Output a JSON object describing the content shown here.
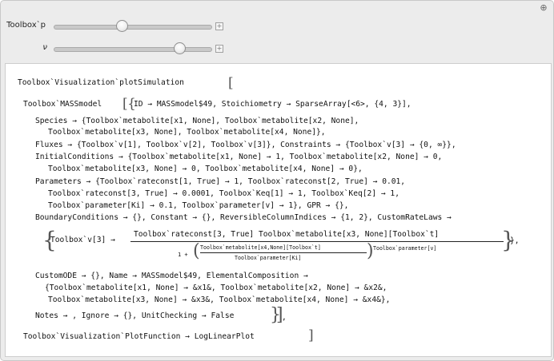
{
  "controls": [
    {
      "label": "Toolbox`p",
      "value_fraction": 0.41
    },
    {
      "label": "ν",
      "value_fraction": 0.78
    }
  ],
  "icons": {
    "expand": "plus-icon",
    "add": "plus-icon"
  },
  "output": {
    "line1": "Toolbox`Visualization`plotSimulation",
    "line2": "Toolbox`MASSmodel",
    "line2b": "ID → MASSmodel$49, Stoichiometry → SparseArray[<6>, {4, 3}],",
    "species1": "Species → {Toolbox`metabolite[x1, None], Toolbox`metabolite[x2, None],",
    "species2": "Toolbox`metabolite[x3, None], Toolbox`metabolite[x4, None]},",
    "fluxes": "Fluxes → {Toolbox`v[1], Toolbox`v[2], Toolbox`v[3]}, Constraints → {Toolbox`v[3] → {0, ∞}},",
    "init1": "InitialConditions → {Toolbox`metabolite[x1, None] → 1, Toolbox`metabolite[x2, None] → 0,",
    "init2": "Toolbox`metabolite[x3, None] → 0, Toolbox`metabolite[x4, None] → 0},",
    "param1": "Parameters → {Toolbox`rateconst[1, True] → 1, Toolbox`rateconst[2, True] → 0.01,",
    "param2": "Toolbox`rateconst[3, True] → 0.0001, Toolbox`Keq[1] → 1, Toolbox`Keq[2] → 1,",
    "param3": "Toolbox`parameter[Ki] → 0.1, Toolbox`parameter[v] → 1}, GPR → {},",
    "bound": "BoundaryConditions → {}, Constant → {}, ReversibleColumnIndices → {1, 2}, CustomRateLaws →",
    "rate_lhs": "Toolbox`v[3] →",
    "rate_num": "Toolbox`rateconst[3, True] Toolbox`metabolite[x3, None][Toolbox`t]",
    "rate_den_prefix": "1 +",
    "rate_inner_num": "Toolbox`metabolite[x4,None][Toolbox`t]",
    "rate_inner_den": "Toolbox`parameter[Ki]",
    "rate_exp": "Toolbox`parameter[v]",
    "rate_close": "},",
    "custom1": "CustomODE → {}, Name → MASSmodel$49, ElementalComposition →",
    "custom2": "{Toolbox`metabolite[x1, None] → &x1&, Toolbox`metabolite[x2, None] → &x2&,",
    "custom3": "Toolbox`metabolite[x3, None] → &x3&, Toolbox`metabolite[x4, None] → &x4&},",
    "notes": "Notes → , Ignore → {}, UnitChecking → False",
    "notes_close": ",",
    "plotfn": "Toolbox`Visualization`PlotFunction → LogLinearPlot"
  }
}
